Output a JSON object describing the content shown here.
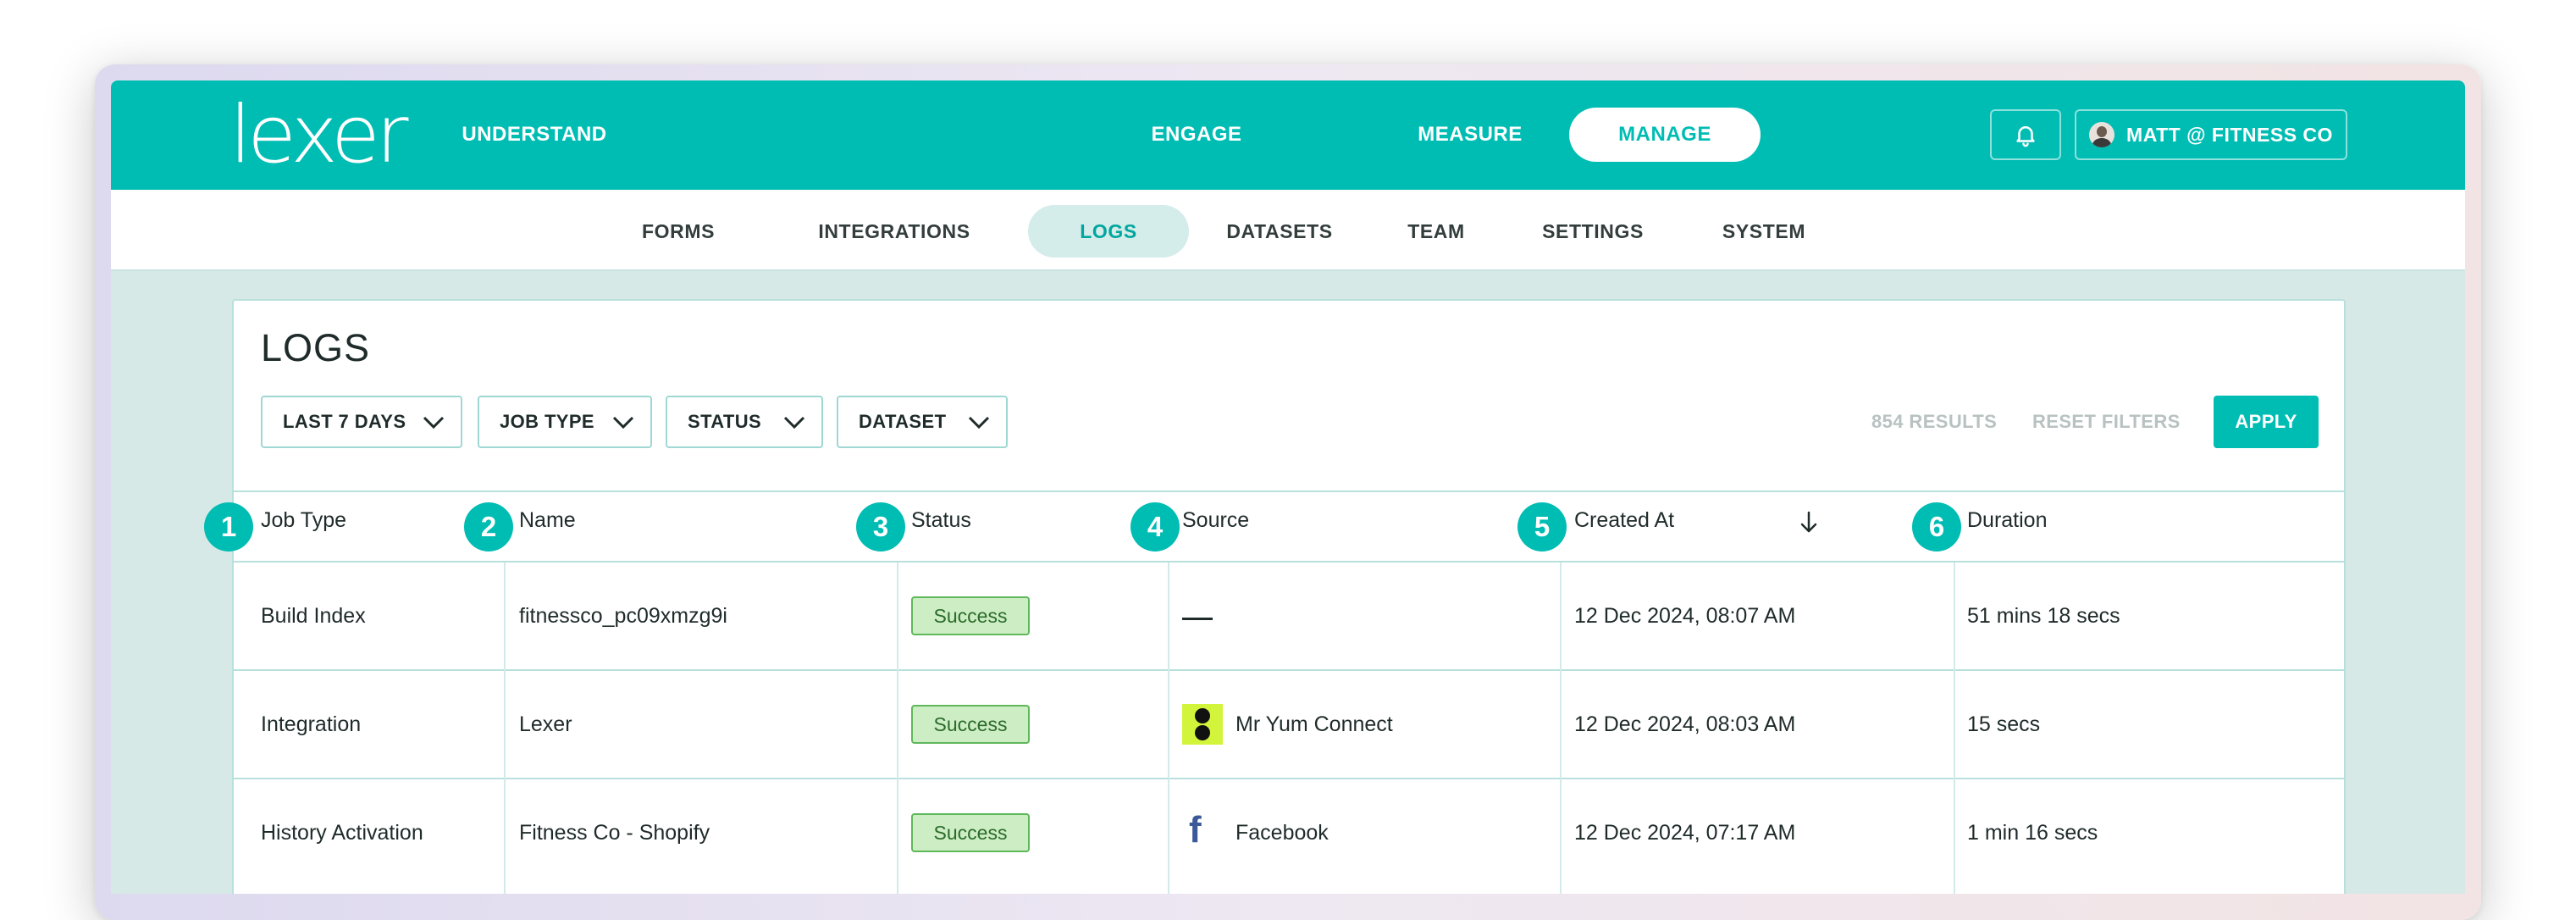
{
  "brand": {
    "logo_text": "lexer"
  },
  "top_nav": {
    "items": [
      "UNDERSTAND",
      "ENGAGE",
      "MEASURE",
      "MANAGE"
    ],
    "active": "MANAGE"
  },
  "user_menu": {
    "label": "MATT @ FITNESS CO"
  },
  "sub_nav": {
    "items": [
      "FORMS",
      "INTEGRATIONS",
      "LOGS",
      "DATASETS",
      "TEAM",
      "SETTINGS",
      "SYSTEM"
    ],
    "active": "LOGS"
  },
  "page": {
    "title": "LOGS"
  },
  "filters": {
    "date": "LAST 7 DAYS",
    "job_type": "JOB TYPE",
    "status": "STATUS",
    "dataset": "DATASET",
    "results": "854 RESULTS",
    "reset": "RESET FILTERS",
    "apply": "APPLY"
  },
  "table": {
    "columns": [
      "Job Type",
      "Name",
      "Status",
      "Source",
      "Created At",
      "Duration"
    ],
    "column_numbers": [
      "1",
      "2",
      "3",
      "4",
      "5",
      "6"
    ],
    "sort": {
      "column": "Created At",
      "direction": "descending"
    },
    "rows": [
      {
        "job_type": "Build Index",
        "name": "fitnessco_pc09xmzg9i",
        "status": "Success",
        "source": "—",
        "source_icon": "none",
        "created_at": "12 Dec 2024, 08:07 AM",
        "duration": "51 mins 18 secs"
      },
      {
        "job_type": "Integration",
        "name": "Lexer",
        "status": "Success",
        "source": "Mr Yum Connect",
        "source_icon": "mr-yum-logo",
        "created_at": "12 Dec 2024, 08:03 AM",
        "duration": "15 secs"
      },
      {
        "job_type": "History Activation",
        "name": "Fitness Co - Shopify",
        "status": "Success",
        "source": "Facebook",
        "source_icon": "facebook-logo",
        "created_at": "12 Dec 2024, 07:17 AM",
        "duration": "1 min 16 secs"
      }
    ]
  },
  "colors": {
    "brand_teal": "#00bdb4",
    "success_bg": "#cdedc4",
    "success_border": "#5fb85a",
    "page_bg": "#d6e9e7"
  }
}
